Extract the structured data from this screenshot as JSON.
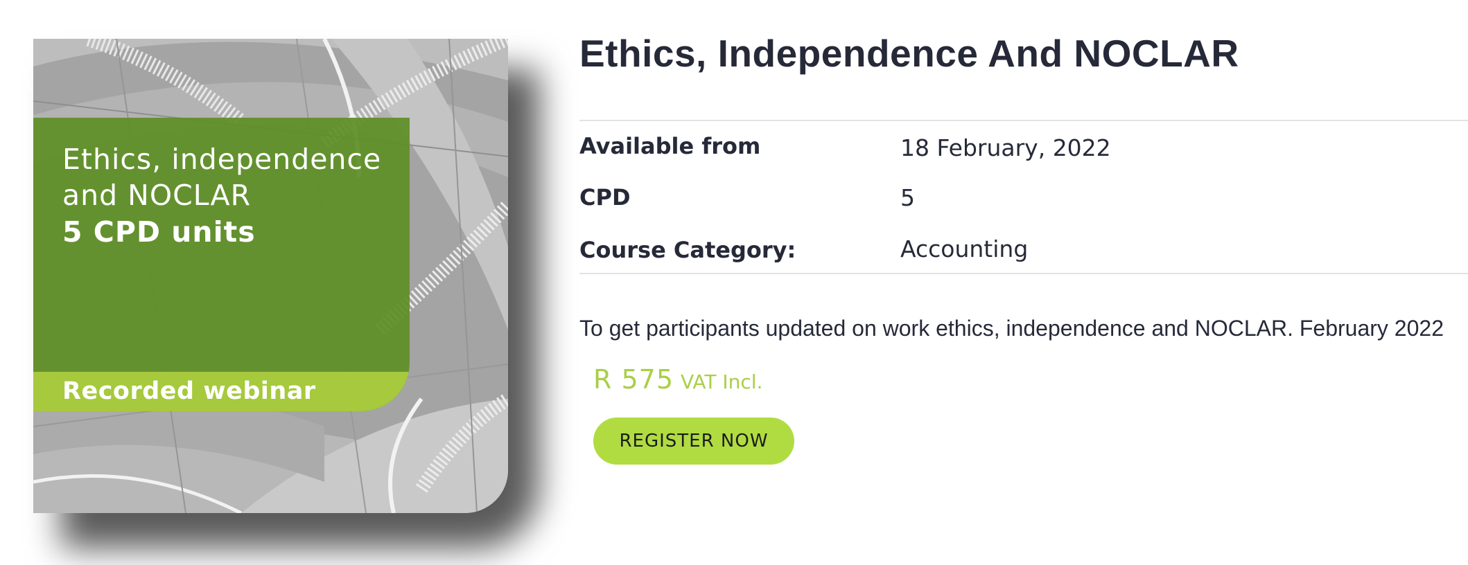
{
  "course_image": {
    "title_line1": "Ethics, independence",
    "title_line2": "and NOCLAR",
    "units": "5 CPD units",
    "format": "Recorded webinar",
    "colors": {
      "panel": "#5f8f26",
      "band": "#a6c93d"
    }
  },
  "course": {
    "title": "Ethics, Independence And NOCLAR",
    "details": [
      {
        "label": "Available from",
        "value": "18 February, 2022"
      },
      {
        "label": "CPD",
        "value": "5"
      },
      {
        "label": "Course Category:",
        "value": "Accounting"
      }
    ],
    "description": "To get participants updated on work ethics, independence and NOCLAR. February 2022",
    "price": {
      "amount": "R 575",
      "vat": "VAT Incl."
    },
    "register_label": "REGISTER NOW"
  },
  "colors": {
    "heading": "#262938",
    "accent": "#b0dc42",
    "price": "#a9cf46"
  }
}
